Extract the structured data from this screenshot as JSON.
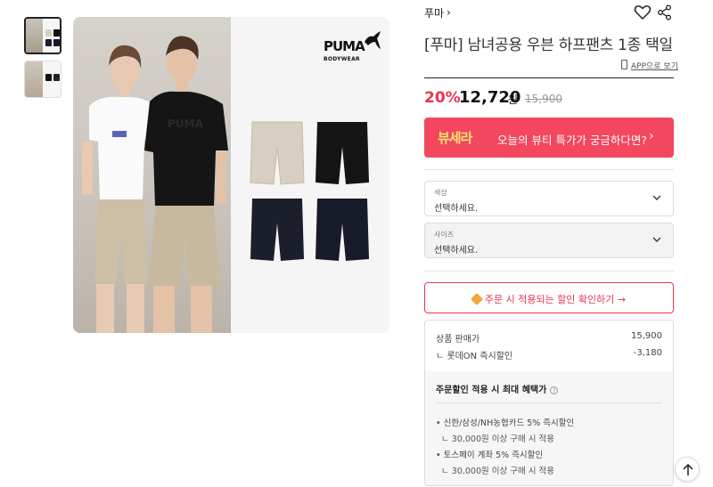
{
  "thumbnails": [
    {
      "label": "thumbnail-1",
      "active": true
    },
    {
      "label": "thumbnail-2",
      "active": false
    }
  ],
  "image": {
    "logo_text": "PUMA",
    "logo_sub": "BODYWEAR"
  },
  "product": {
    "brand": "푸마",
    "brand_chevron": "›",
    "title": "[푸마] 남녀공용 우븐 하프팬츠 1종 택일",
    "app_link": "APP으로 보기"
  },
  "price": {
    "discount": "20%",
    "sale_price": "12,720",
    "unit": "원",
    "original_price": "15,900"
  },
  "banner": {
    "logo": "뷰세라",
    "text": "오늘의 뷰티 특가가 궁금하다면?",
    "arrow": "›",
    "bg_color": "#f2475e"
  },
  "options": [
    {
      "label": "색상",
      "value": "선택하세요."
    },
    {
      "label": "사이즈",
      "value": "선택하세요."
    }
  ],
  "coupon_button": "주문 시 적용되는 할인 확인하기 →",
  "breakdown": {
    "rows": [
      {
        "label": "상품 판매가",
        "value": "15,900"
      },
      {
        "label": "ㄴ 롯데ON 즉시할인",
        "value": "-3,180"
      }
    ],
    "max_benefit_title": "주문할인 적용 시 최대 혜택가",
    "info_icon": "?",
    "items": [
      {
        "text": "• 신한/삼성/NH농협카드 5% 즉시할인",
        "sub": "ㄴ 30,000원 이상 구매 시 적용"
      },
      {
        "text": "• 토스페이 계좌 5% 즉시할인",
        "sub": "ㄴ 30,000원 이상 구매 시 적용"
      }
    ]
  },
  "icons": {
    "wishlist": "heart-icon",
    "share": "share-icon",
    "app": "phone-icon",
    "top": "arrow-up-icon"
  },
  "colors": {
    "accent": "#e8344e",
    "banner_logo": "#ffe36e"
  }
}
